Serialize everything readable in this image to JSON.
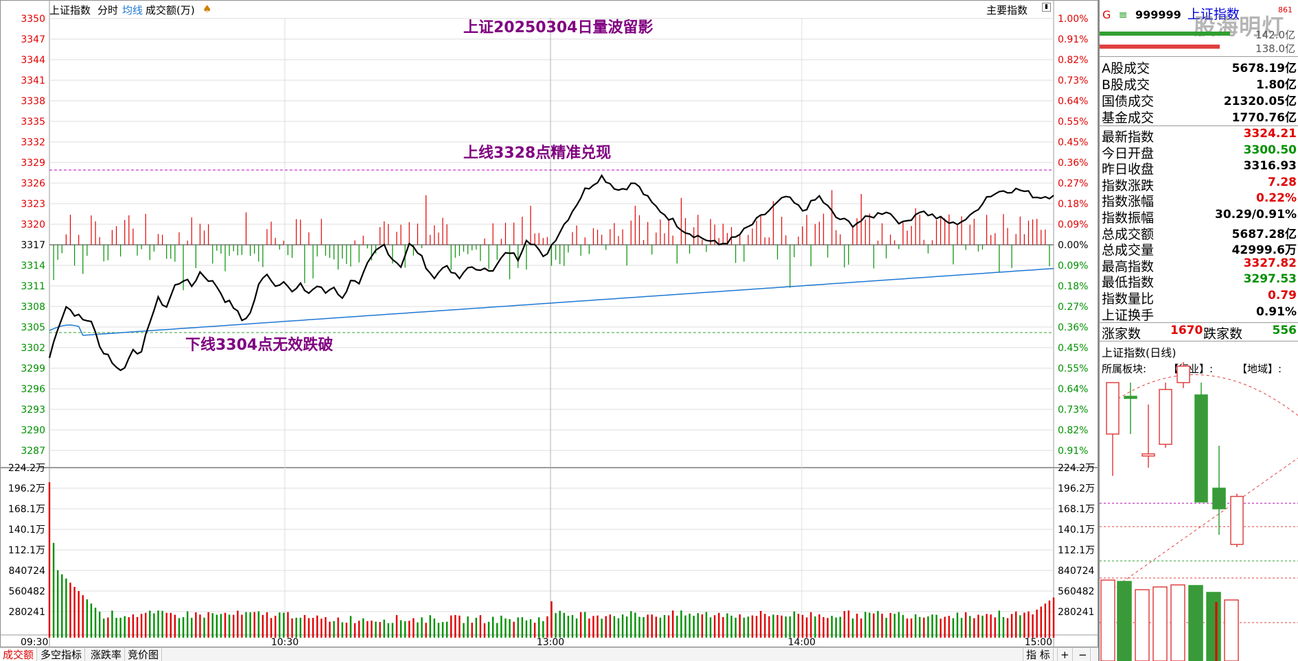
{
  "toolbar": {
    "index_name": "上证指数",
    "tabs": [
      "分时",
      "均线",
      "成交额(万)"
    ],
    "main_indicator_label": "主要指数"
  },
  "annotations": {
    "title": "上证20250304日量波留影",
    "upper_note": "上线3328点精准兑现",
    "lower_note": "下线3304点无效跌破"
  },
  "colors": {
    "up": "#e00000",
    "down": "#009000",
    "price_line": "#000000",
    "avg_line": "#1e78d2",
    "annotation": "#800080",
    "grid": "#dcdcdc"
  },
  "y_axis_left": [
    "3350",
    "3347",
    "3344",
    "3341",
    "3338",
    "3335",
    "3332",
    "3329",
    "3326",
    "3323",
    "3320",
    "3317",
    "3314",
    "3311",
    "3308",
    "3305",
    "3302",
    "3299",
    "3296",
    "3293",
    "3290",
    "3287"
  ],
  "y_axis_right": [
    "1.00%",
    "0.91%",
    "0.82%",
    "0.73%",
    "0.64%",
    "0.55%",
    "0.45%",
    "0.36%",
    "0.27%",
    "0.18%",
    "0.09%",
    "0.00%",
    "0.09%",
    "0.18%",
    "0.27%",
    "0.36%",
    "0.45%",
    "0.55%",
    "0.64%",
    "0.73%",
    "0.82%",
    "0.91%"
  ],
  "volume_axis": [
    "224.2万",
    "196.2万",
    "168.1万",
    "140.1万",
    "112.1万",
    "840724",
    "560482",
    "280241"
  ],
  "x_axis": [
    "09:30",
    "10:30",
    "13:00",
    "14:00",
    "15:00"
  ],
  "bottom_tabs": [
    "成交额",
    "多空指标",
    "涨跌率",
    "竞价图"
  ],
  "bottom_right": {
    "indicator": "指 标",
    "plus": "+",
    "minus": "−"
  },
  "right_panel": {
    "header": {
      "flag": "G",
      "menu": "≡",
      "code": "999999",
      "name": "上证指数",
      "corner": "861"
    },
    "bars": {
      "top_value": "142.0亿",
      "bottom_value": "138.0亿"
    },
    "turnover": [
      {
        "label": "A股成交",
        "value": "5678.19亿"
      },
      {
        "label": "B股成交",
        "value": "1.80亿"
      },
      {
        "label": "国债成交",
        "value": "21320.05亿"
      },
      {
        "label": "基金成交",
        "value": "1770.76亿"
      }
    ],
    "stats": [
      {
        "label": "最新指数",
        "value": "3324.21",
        "color": "red"
      },
      {
        "label": "今日开盘",
        "value": "3300.50",
        "color": "green"
      },
      {
        "label": "昨日收盘",
        "value": "3316.93",
        "color": "black"
      },
      {
        "label": "指数涨跌",
        "value": "7.28",
        "color": "red"
      },
      {
        "label": "指数涨幅",
        "value": "0.22%",
        "color": "red"
      },
      {
        "label": "指数振幅",
        "value": "30.29/0.91%",
        "color": "black"
      },
      {
        "label": "总成交额",
        "value": "5687.28亿",
        "color": "black"
      },
      {
        "label": "总成交量",
        "value": "42999.6万",
        "color": "black"
      },
      {
        "label": "最高指数",
        "value": "3327.82",
        "color": "red"
      },
      {
        "label": "最低指数",
        "value": "3297.53",
        "color": "green"
      },
      {
        "label": "指数量比",
        "value": "0.79",
        "color": "red"
      },
      {
        "label": "上证换手",
        "value": "0.91%",
        "color": "black"
      }
    ],
    "breadth": {
      "up_label": "涨家数",
      "up_value": "1670",
      "down_label": "跌家数",
      "down_value": "556"
    },
    "daily_title": "上证指数(日线)",
    "sector_labels": {
      "sector": "所属板块:",
      "industry": "【行业】:",
      "region": "【地域】:"
    }
  },
  "watermark": "股海明灯"
}
